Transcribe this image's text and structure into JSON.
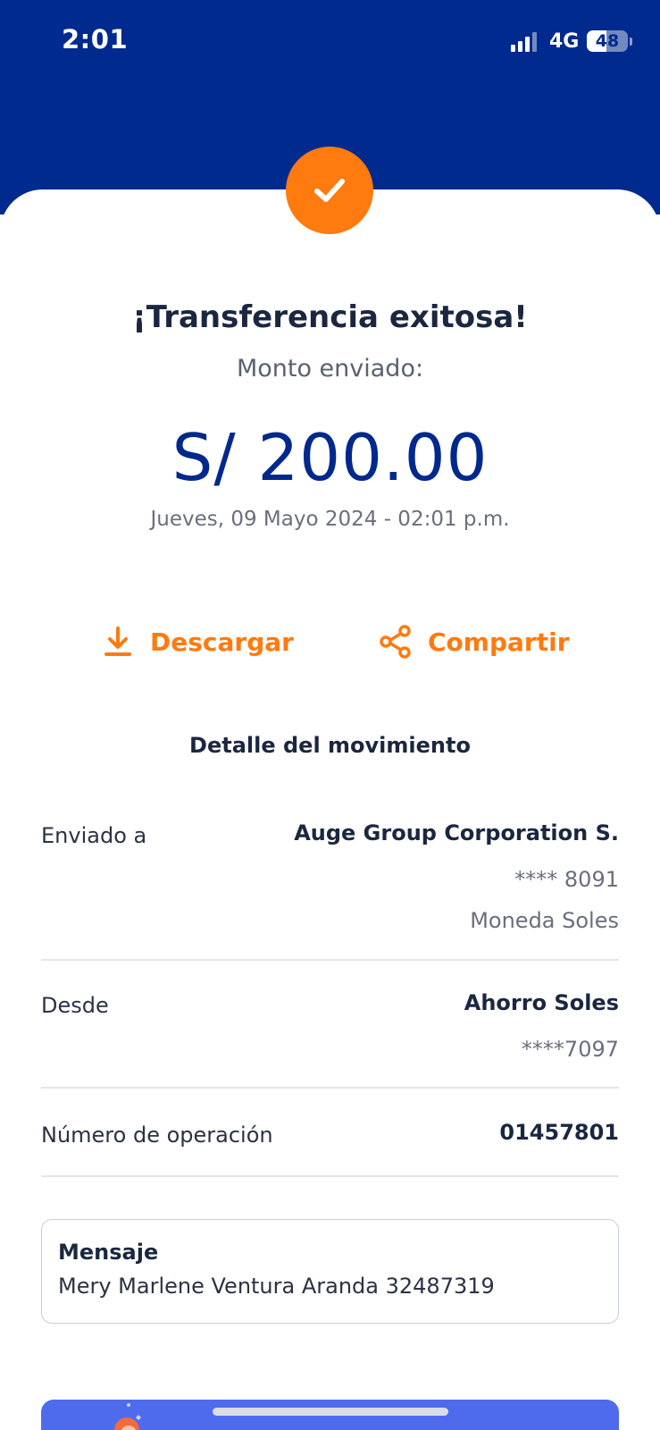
{
  "status_bar": {
    "time": "2:01",
    "network": "4G",
    "battery": "48",
    "battery_level": 0.48
  },
  "header": {
    "title": "¡Transferencia exitosa!",
    "subtitle": "Monto enviado:",
    "amount": "S/ 200.00",
    "datetime": "Jueves, 09 Mayo 2024 - 02:01 p.m."
  },
  "actions": {
    "download_label": "Descargar",
    "share_label": "Compartir"
  },
  "details": {
    "section_title": "Detalle del movimiento",
    "sent_to": {
      "label": "Enviado a",
      "name": "Auge Group Corporation S.",
      "account": "**** 8091",
      "currency": "Moneda Soles"
    },
    "from": {
      "label": "Desde",
      "account_name": "Ahorro Soles",
      "account": "****7097"
    },
    "operation": {
      "label": "Número de operación",
      "number": "01457801"
    }
  },
  "message": {
    "title": "Mensaje",
    "text": "Mery Marlene Ventura Aranda 32487319"
  },
  "colors": {
    "brand_blue": "#002a8d",
    "accent_orange": "#ff7a0f",
    "banner_blue": "#4f6bed"
  },
  "icons": {
    "success": "checkmark-icon",
    "download": "download-icon",
    "share": "share-icon",
    "signal": "signal-icon"
  }
}
